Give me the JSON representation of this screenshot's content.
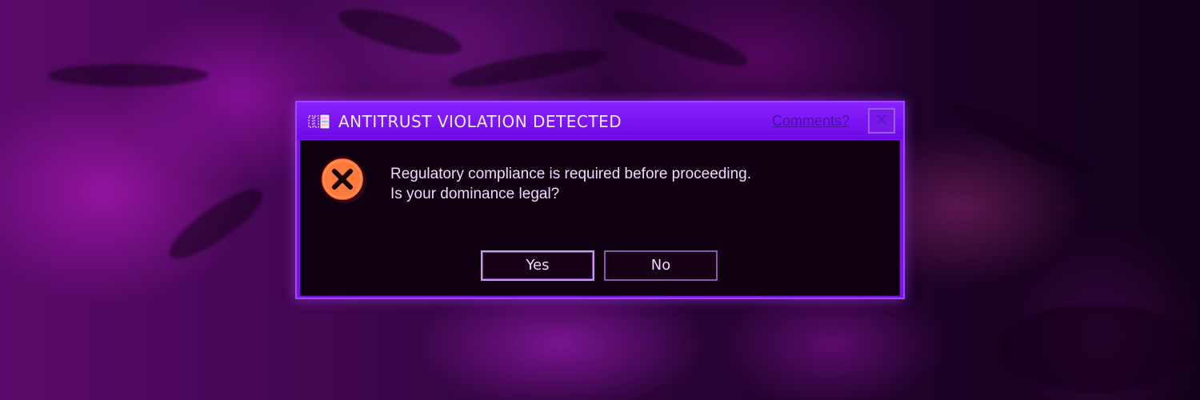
{
  "dialog": {
    "title": "ANTITRUST VIOLATION DETECTED",
    "comments_link": "Comments?",
    "close_glyph": "✕",
    "message_line1": "Regulatory compliance is required before proceeding.",
    "message_line2": "Is your dominance legal?",
    "buttons": {
      "yes_label": "Yes",
      "no_label": "No"
    },
    "icons": {
      "title": "application-icon",
      "message": "error-icon",
      "close": "close-icon"
    }
  },
  "colors": {
    "titlebar": "#7d12f0",
    "body": "#0f0010",
    "text": "#f2d8ff",
    "error_icon": "#ff7a3d",
    "link": "#4a0fa8"
  }
}
